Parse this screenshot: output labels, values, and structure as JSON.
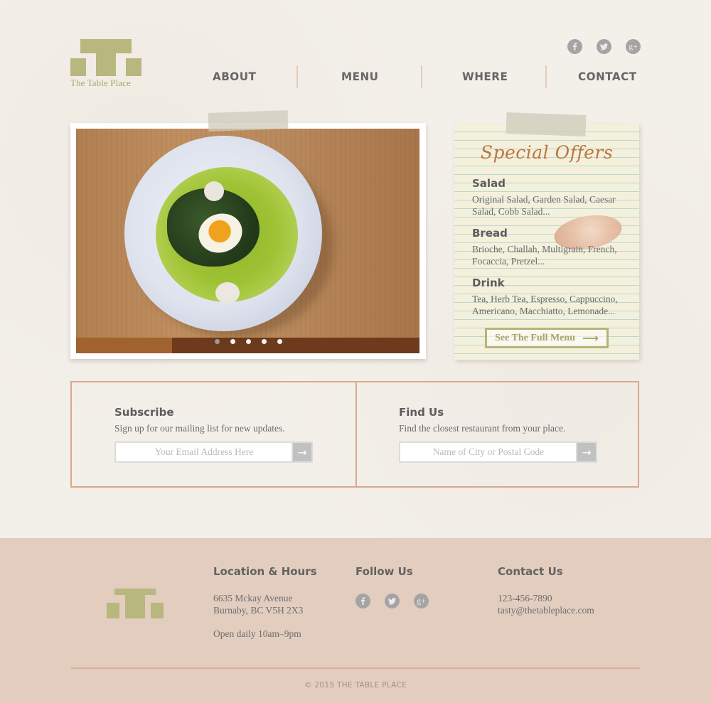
{
  "brand": {
    "name": "The Table Place",
    "logo_color": "#b8b77e",
    "accent_color": "#c0743e",
    "border_color": "#d9a98a",
    "footer_bg": "#e2cdbf"
  },
  "header": {
    "social": [
      {
        "name": "facebook",
        "glyph": "f"
      },
      {
        "name": "twitter",
        "glyph": "t"
      },
      {
        "name": "google-plus",
        "glyph": "g+"
      }
    ],
    "nav": [
      {
        "label": "ABOUT"
      },
      {
        "label": "MENU"
      },
      {
        "label": "WHERE"
      },
      {
        "label": "CONTACT"
      }
    ]
  },
  "slider": {
    "image_alt": "Plate of greens with soft-boiled egg in herb broth",
    "slide_count": 5,
    "active_slide": 1
  },
  "offers": {
    "title": "Special Offers",
    "items": [
      {
        "heading": "Salad",
        "text": "Original Salad, Garden Salad, Caesar Salad, Cobb Salad..."
      },
      {
        "heading": "Bread",
        "text": "Brioche, Challah, Multigrain, French, Focaccia, Pretzel..."
      },
      {
        "heading": "Drink",
        "text": "Tea, Herb Tea, Espresso, Cappuccino, Americano, Macchiatto, Lemonade..."
      }
    ],
    "button_label": "See The Full Menu",
    "button_arrow": "⟶"
  },
  "subscribe": {
    "heading": "Subscribe",
    "text": "Sign up for our mailing list for new updates.",
    "placeholder": "Your Email Address Here",
    "value": "",
    "submit_glyph": "→"
  },
  "find_us": {
    "heading": "Find Us",
    "text": "Find the closest restaurant from your place.",
    "placeholder": "Name of City or Postal Code",
    "value": "",
    "submit_glyph": "→"
  },
  "footer": {
    "location": {
      "heading": "Location & Hours",
      "address_line1": "6635 Mckay Avenue",
      "address_line2": "Burnaby, BC V5H 2X3",
      "hours": "Open daily 10am–9pm"
    },
    "follow": {
      "heading": "Follow Us"
    },
    "contact": {
      "heading": "Contact Us",
      "phone": "123-456-7890",
      "email": "tasty@thetableplace.com"
    },
    "copyright": "© 2015 THE TABLE PLACE"
  }
}
